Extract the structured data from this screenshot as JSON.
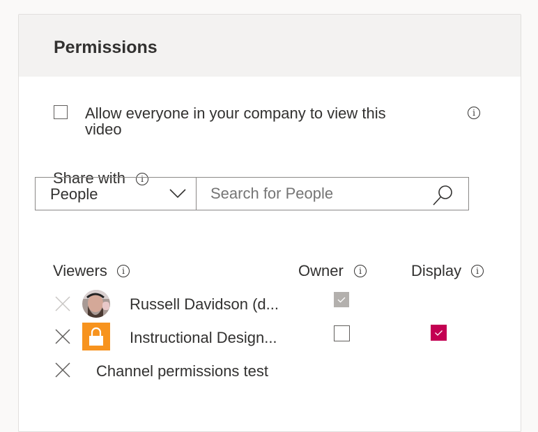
{
  "panel": {
    "title": "Permissions"
  },
  "allow_everyone": {
    "label_line1": "Allow everyone in your company to view this",
    "label_line2": "video",
    "checked": false
  },
  "share_with": {
    "label": "Share with",
    "type_select": {
      "value": "People"
    },
    "search": {
      "placeholder": "Search for People",
      "value": ""
    }
  },
  "columns": {
    "viewers": "Viewers",
    "owner": "Owner",
    "display": "Display"
  },
  "viewers": [
    {
      "name": "Russell Davidson (d...",
      "avatar": "photo",
      "owner": true,
      "owner_disabled": true,
      "display": null
    },
    {
      "name": "Instructional Design...",
      "avatar": "lock-icon",
      "avatar_color": "#f7931e",
      "owner": false,
      "display": true
    },
    {
      "name": "Channel permissions test",
      "avatar": null,
      "owner": null,
      "display": null
    }
  ],
  "colors": {
    "accent": "#c30052",
    "lock_bg": "#f7931e",
    "disabled_check": "#b3b0ad"
  }
}
